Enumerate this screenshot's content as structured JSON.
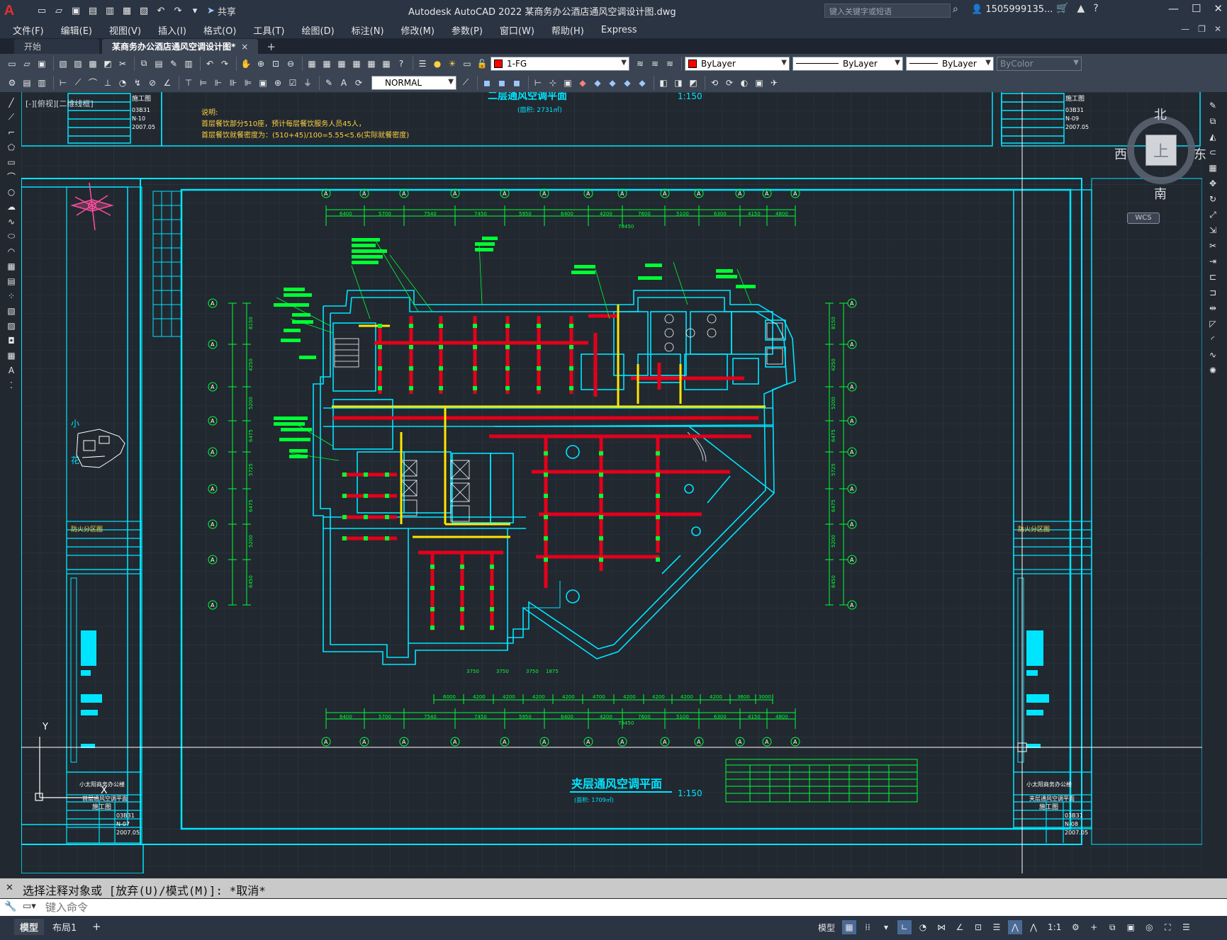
{
  "app": {
    "logo": "A",
    "title": "Autodesk AutoCAD 2022    某商务办公酒店通风空调设计图.dwg",
    "share_label": "共享",
    "search_placeholder": "键入关键字或短语",
    "user_name": "1505999135..."
  },
  "menu": [
    "文件(F)",
    "编辑(E)",
    "视图(V)",
    "插入(I)",
    "格式(O)",
    "工具(T)",
    "绘图(D)",
    "标注(N)",
    "修改(M)",
    "参数(P)",
    "窗口(W)",
    "帮助(H)",
    "Express"
  ],
  "tabs": {
    "start": "开始",
    "active": "某商务办公酒店通风空调设计图*",
    "close": "×",
    "add": "+"
  },
  "toolbar": {
    "layer": "1-FG",
    "color": "ByLayer",
    "linetype": "ByLayer",
    "lineweight": "ByLayer",
    "plotstyle": "ByColor",
    "dimstyle": "NORMAL",
    "layer_color": "#ff0000"
  },
  "viewport_label": "[-][俯视][二维线框]",
  "viewcube": {
    "north": "北",
    "south": "南",
    "east": "东",
    "west": "西",
    "face": "上",
    "wcs": "WCS"
  },
  "drawing": {
    "main_title": "夹层通风空调平面",
    "main_scale": "1:150",
    "main_area": "(面积: 1709㎡)",
    "top_title": "二层通风空调平面",
    "top_scale": "1:150",
    "top_area": "(面积: 2731㎡)",
    "note_heading": "说明:",
    "note_line1": "首层餐饮部分510座，预计每层餐饮服务人员45人，",
    "note_line2": "首层餐饮就餐密度为：(510+45)/100=5.55<5.6(实际就餐密度)",
    "overall_dim": "78450",
    "dims_top": [
      "6400",
      "5700",
      "7540",
      "7450",
      "5950",
      "6400",
      "4200",
      "7600",
      "5100",
      "6300",
      "4150",
      "4800"
    ],
    "dims_left": [
      "8150",
      "4250",
      "5200",
      "6475",
      "5725",
      "6475",
      "5200",
      "6450"
    ],
    "dims_bottom_inner": [
      "6000",
      "4200",
      "4200",
      "4200",
      "4200",
      "4700",
      "4200",
      "4200",
      "4200",
      "4200",
      "3600",
      "3000"
    ],
    "dims_lower": [
      "3750",
      "3750",
      "3750",
      "1875"
    ],
    "grid_marker": "A",
    "title_block_left": {
      "project": "小太阳商务办公楼",
      "drawing": "首层通风空调平面",
      "stage": "施工图",
      "no1": "03B31",
      "no2": "N-07",
      "date": "2007.05",
      "legend": "防火分区图",
      "side1": "小",
      "side2": "花"
    },
    "title_block_right": {
      "project": "小太阳商务办公楼",
      "drawing": "夹层通风空调平面",
      "stage": "施工图",
      "no1": "03B31",
      "no2": "N-08",
      "date": "2007.05",
      "legend": "防火分区图"
    },
    "title_block_top_left": {
      "no1": "03B31",
      "no2": "N-10",
      "date": "2007.05",
      "stage": "施工图"
    },
    "title_block_top_right": {
      "no1": "03B31",
      "no2": "N-09",
      "date": "2007.05",
      "stage": "施工图"
    },
    "ucs_x": "X",
    "ucs_y": "Y"
  },
  "command": {
    "history": "选择注释对象或 [放弃(U)/模式(M)]: *取消*",
    "placeholder": "键入命令"
  },
  "status": {
    "model_tab": "模型",
    "layout_tab": "布局1",
    "add": "+",
    "model_label": "模型",
    "scale": "1:1"
  }
}
